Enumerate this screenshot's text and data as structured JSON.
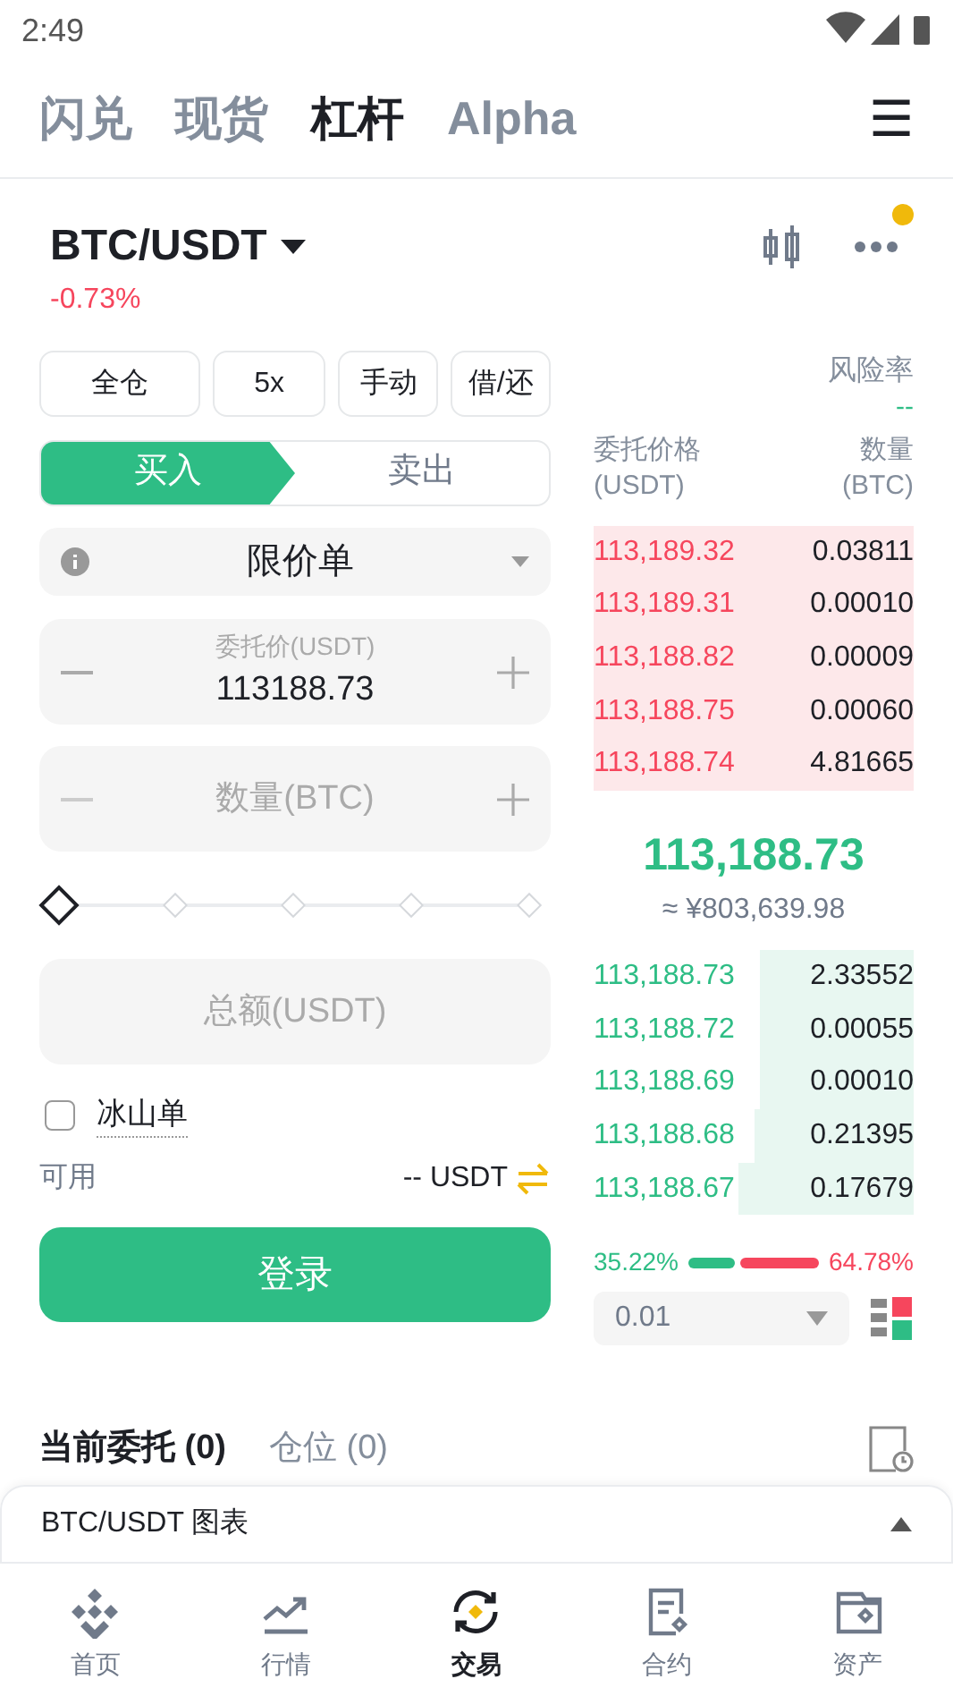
{
  "status_bar": {
    "time": "2:49"
  },
  "top_tabs": [
    {
      "label": "闪兑",
      "selected": false
    },
    {
      "label": "现货",
      "selected": false
    },
    {
      "label": "杠杆",
      "selected": true
    },
    {
      "label": "Alpha",
      "selected": false
    }
  ],
  "menu_icon": "☰",
  "pair": {
    "name": "BTC/USDT",
    "change": "-0.73%",
    "notification": true
  },
  "mode_buttons": [
    "全仓",
    "5x",
    "手动",
    "借/还"
  ],
  "risk": {
    "label": "风险率",
    "value": "--"
  },
  "sides": [
    {
      "label": "买入",
      "selected": true
    },
    {
      "label": "卖出",
      "selected": false
    }
  ],
  "order_type": "限价单",
  "price_field": {
    "label": "委托价(USDT)",
    "value": "113188.73"
  },
  "quantity_field": {
    "placeholder": "数量(BTC)"
  },
  "slider": {
    "level": 0
  },
  "total_field": {
    "placeholder": "总额(USDT)"
  },
  "iceberg": {
    "label": "冰山单",
    "checked": false
  },
  "available": {
    "label": "可用",
    "value": "-- USDT"
  },
  "login_button": "登录",
  "order_book": {
    "price_header": "委托价格",
    "price_unit": "(USDT)",
    "amount_header": "数量",
    "amount_unit": "(BTC)",
    "asks": [
      {
        "price": "113,189.32",
        "amount": "0.03811"
      },
      {
        "price": "113,189.31",
        "amount": "0.00010"
      },
      {
        "price": "113,188.82",
        "amount": "0.00009"
      },
      {
        "price": "113,188.75",
        "amount": "0.00060"
      },
      {
        "price": "113,188.74",
        "amount": "4.81665"
      }
    ],
    "last_price": "113,188.73",
    "last_price_cny": "≈ ¥803,639.98",
    "bids": [
      {
        "price": "113,188.73",
        "amount": "2.33552"
      },
      {
        "price": "113,188.72",
        "amount": "0.00055"
      },
      {
        "price": "113,188.69",
        "amount": "0.00010"
      },
      {
        "price": "113,188.68",
        "amount": "0.21395"
      },
      {
        "price": "113,188.67",
        "amount": "0.17679"
      }
    ],
    "buy_ratio": "35.22%",
    "sell_ratio": "64.78%",
    "ratio": {
      "level": 0.3522
    },
    "precision": "0.01"
  },
  "order_tabs": [
    {
      "label": "当前委托 (0)",
      "selected": true
    },
    {
      "label": "仓位 (0)",
      "selected": false
    }
  ],
  "chart_bar": {
    "label": "BTC/USDT 图表"
  },
  "bottom_nav": [
    {
      "label": "首页",
      "kind": "home",
      "selected": false
    },
    {
      "label": "行情",
      "kind": "markets",
      "selected": false
    },
    {
      "label": "交易",
      "kind": "trade",
      "selected": true
    },
    {
      "label": "合约",
      "kind": "futures",
      "selected": false
    },
    {
      "label": "资产",
      "kind": "assets",
      "selected": false
    }
  ]
}
